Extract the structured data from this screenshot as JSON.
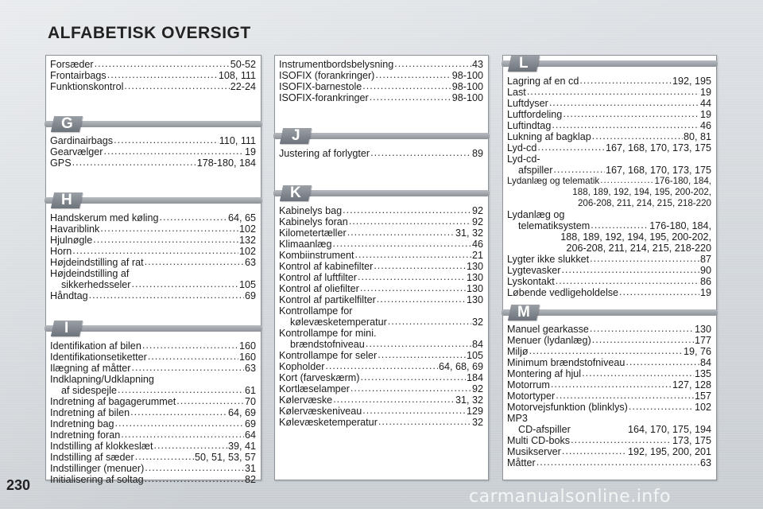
{
  "header": {
    "title": "ALFABETISK OVERSIGT"
  },
  "footer": {
    "page_number": "230",
    "watermark": "carmanualsonline.info"
  },
  "columns": {
    "c1": {
      "top": [
        {
          "term": "Forsæder",
          "pages": "50-52"
        },
        {
          "term": "Frontairbags",
          "pages": "108, 111"
        },
        {
          "term": "Funktionskontrol",
          "pages": "22-24"
        }
      ],
      "G": {
        "letter": "G",
        "entries": [
          {
            "term": "Gardinairbags",
            "pages": "110, 111"
          },
          {
            "term": "Gearvælger",
            "pages": "19"
          },
          {
            "term": "GPS",
            "pages": "178-180, 184"
          }
        ]
      },
      "H": {
        "letter": "H",
        "entries": [
          {
            "term": "Handskerum med køling",
            "pages": "64, 65"
          },
          {
            "term": "Havariblink",
            "pages": "102"
          },
          {
            "term": "Hjulnøgle",
            "pages": "132"
          },
          {
            "term": "Horn",
            "pages": "102"
          },
          {
            "term": "Højdeindstilling af rat",
            "pages": "63"
          },
          {
            "term": "Højdeindstilling af",
            "cont": "sikkerhedsseler",
            "pages": "105"
          },
          {
            "term": "Håndtag",
            "pages": "69"
          }
        ]
      },
      "I": {
        "letter": "I",
        "entries": [
          {
            "term": "Identifikation af bilen",
            "pages": "160"
          },
          {
            "term": "Identifikationsetiketter",
            "pages": "160"
          },
          {
            "term": "Ilægning af måtter",
            "pages": "63"
          },
          {
            "term": "Indklapning/Udklapning",
            "cont": "af sidespejle",
            "pages": "61"
          },
          {
            "term": "Indretning af bagagerummet",
            "pages": "70"
          },
          {
            "term": "Indretning af bilen",
            "pages": "64, 69"
          },
          {
            "term": "Indretning bag",
            "pages": "69"
          },
          {
            "term": "Indretning foran",
            "pages": "64"
          },
          {
            "term": "Indstilling af klokkeslæt",
            "pages": "39, 41"
          },
          {
            "term": "Indstilling af sæder",
            "pages": "50, 51, 53, 57"
          },
          {
            "term": "Indstillinger (menuer)",
            "pages": "31"
          },
          {
            "term": "Initialisering af soltag",
            "pages": "82"
          }
        ]
      }
    },
    "c2": {
      "top": [
        {
          "term": "Instrumentbordsbelysning",
          "pages": "43"
        },
        {
          "term": "ISOFIX (forankringer)",
          "pages": "98-100"
        },
        {
          "term": "ISOFIX-barnestole",
          "pages": "98-100"
        },
        {
          "term": "ISOFIX-forankringer",
          "pages": "98-100"
        }
      ],
      "J": {
        "letter": "J",
        "entries": [
          {
            "term": "Justering af forlygter",
            "pages": "89"
          }
        ]
      },
      "K": {
        "letter": "K",
        "entries": [
          {
            "term": "Kabinelys bag",
            "pages": "92"
          },
          {
            "term": "Kabinelys foran",
            "pages": "92"
          },
          {
            "term": "Kilometertæller",
            "pages": "31, 32"
          },
          {
            "term": "Klimaanlæg",
            "pages": "46"
          },
          {
            "term": "Kombiinstrument",
            "pages": "21"
          },
          {
            "term": "Kontrol af kabinefilter",
            "pages": "130"
          },
          {
            "term": "Kontrol af luftfilter",
            "pages": "130"
          },
          {
            "term": "Kontrol af oliefilter",
            "pages": "130"
          },
          {
            "term": "Kontrol af partikelfilter",
            "pages": "130"
          },
          {
            "term": "Kontrollampe for",
            "cont": "kølevæsketemperatur",
            "pages": "32"
          },
          {
            "term": "Kontrollampe for mini.",
            "cont": "brændstofniveau",
            "pages": "84"
          },
          {
            "term": "Kontrollampe for seler",
            "pages": "105"
          },
          {
            "term": "Kopholder",
            "pages": "64, 68, 69"
          },
          {
            "term": "Kort (farveskærm)",
            "pages": "184"
          },
          {
            "term": "Kortlæselamper",
            "pages": "92"
          },
          {
            "term": "Kølervæske",
            "pages": "31, 32"
          },
          {
            "term": "Kølervæskeniveau",
            "pages": "129"
          },
          {
            "term": "Kølevæsketemperatur",
            "pages": "32"
          }
        ]
      }
    },
    "c3": {
      "L": {
        "letter": "L",
        "entries": [
          {
            "term": "Lagring af en cd",
            "pages": "192, 195"
          },
          {
            "term": "Last",
            "pages": "19"
          },
          {
            "term": "Luftdyser",
            "pages": "44"
          },
          {
            "term": "Luftfordeling",
            "pages": "19"
          },
          {
            "term": "Luftindtag",
            "pages": "46"
          },
          {
            "term": "Lukning af bagklap",
            "pages": "80, 81"
          },
          {
            "term": "Lyd-cd",
            "pages": "167, 168, 170, 173, 175"
          },
          {
            "term": "Lyd-cd-",
            "cont": "afspiller",
            "pages": "167, 168, 170, 173, 175"
          },
          {
            "term": "Lydanlæg og telematik",
            "pages": "176-180, 184,",
            "more": [
              "188, 189, 192, 194, 195, 200-202,",
              "206-208, 211, 214, 215, 218-220"
            ],
            "small": true
          },
          {
            "term": "Lydanlæg og",
            "cont": "telematiksystem",
            "pages": "176-180, 184,",
            "more": [
              "188, 189, 192, 194, 195, 200-202,",
              "206-208, 211, 214, 215, 218-220"
            ]
          },
          {
            "term": "Lygter ikke slukket",
            "pages": "87"
          },
          {
            "term": "Lygtevasker",
            "pages": "90"
          },
          {
            "term": "Lyskontakt",
            "pages": "86"
          },
          {
            "term": "Løbende vedligeholdelse",
            "pages": "19"
          }
        ]
      },
      "M": {
        "letter": "M",
        "entries": [
          {
            "term": "Manuel gearkasse",
            "pages": "130"
          },
          {
            "term": "Menuer (lydanlæg)",
            "pages": "177"
          },
          {
            "term": "Miljø",
            "pages": "19, 76"
          },
          {
            "term": "Minimum brændstofniveau",
            "pages": "84"
          },
          {
            "term": "Montering af hjul",
            "pages": "135"
          },
          {
            "term": "Motorrum",
            "pages": "127, 128"
          },
          {
            "term": "Motortyper",
            "pages": "157"
          },
          {
            "term": "Motorvejsfunktion (blinklys)",
            "pages": "102"
          },
          {
            "term": "MP3",
            "contplain": "CD-afspiller",
            "pages": "164, 170, 175, 194"
          },
          {
            "term": "Multi CD-boks",
            "pages": "173, 175"
          },
          {
            "term": "Musikserver",
            "pages": "192, 195, 200, 201"
          },
          {
            "term": "Måtter",
            "pages": "63"
          }
        ]
      }
    }
  }
}
